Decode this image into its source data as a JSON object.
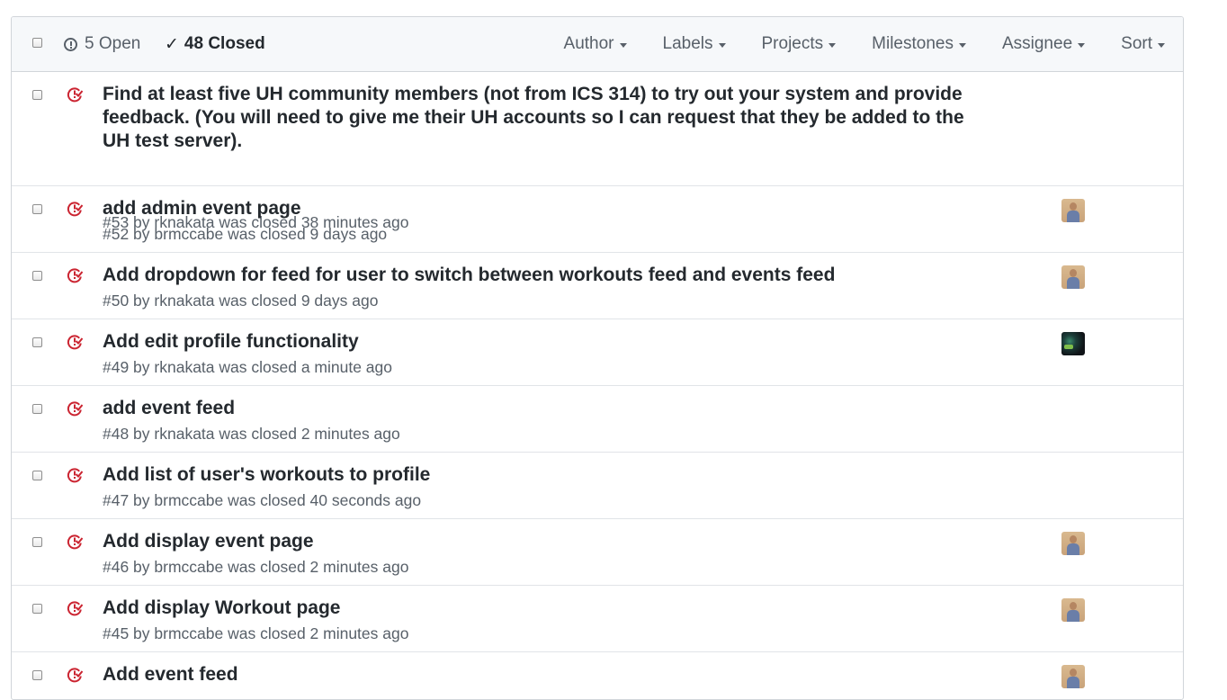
{
  "header": {
    "open_label": "5 Open",
    "closed_label": "48 Closed",
    "filters": [
      "Author",
      "Labels",
      "Projects",
      "Milestones",
      "Assignee",
      "Sort"
    ]
  },
  "issues": [
    {
      "title": "Find at least five UH community members (not from ICS 314) to try out your system and provide feedback. (You will need to give me their UH accounts so I can request that they be added to the UH test server).",
      "meta": "#53 by rknakata was closed 38 minutes ago",
      "avatar": "none"
    },
    {
      "title": "add admin event page",
      "meta": "#52 by brmccabe was closed 9 days ago",
      "avatar": "person"
    },
    {
      "title": "Add dropdown for feed for user to switch between workouts feed and events feed",
      "meta": "#50 by rknakata was closed 9 days ago",
      "avatar": "person"
    },
    {
      "title": "Add edit profile functionality",
      "meta": "#49 by rknakata was closed a minute ago",
      "avatar": "dark"
    },
    {
      "title": "add event feed",
      "meta": "#48 by rknakata was closed 2 minutes ago",
      "avatar": "none"
    },
    {
      "title": "Add list of user's workouts to profile",
      "meta": "#47 by brmccabe was closed 40 seconds ago",
      "avatar": "none"
    },
    {
      "title": "Add display event page",
      "meta": "#46 by brmccabe was closed 2 minutes ago",
      "avatar": "person"
    },
    {
      "title": "Add display Workout page",
      "meta": "#45 by brmccabe was closed 2 minutes ago",
      "avatar": "person"
    },
    {
      "title": "Add event feed",
      "meta": "",
      "avatar": "person"
    }
  ],
  "colors": {
    "closed_icon": "#cb2431",
    "header_bg": "#f6f8fa",
    "border": "#d1d5da"
  }
}
